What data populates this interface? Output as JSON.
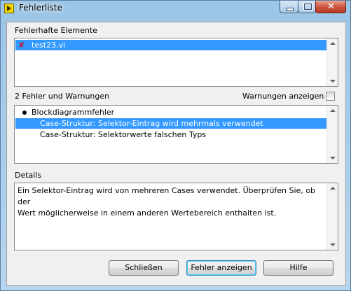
{
  "window": {
    "title": "Fehlerliste"
  },
  "errors_section": {
    "label": "Fehlerhafte Elemente",
    "items": [
      {
        "label": "test23.vi",
        "selected": true
      }
    ]
  },
  "warnings_section": {
    "label": "2 Fehler und Warnungen",
    "show_warnings_label": "Warnungen anzeigen",
    "show_warnings_checked": false,
    "group_label": "Blockdiagrammfehler",
    "items": [
      {
        "label": "Case-Struktur: Selektor-Eintrag wird mehrmals verwendet",
        "selected": true
      },
      {
        "label": "Case-Struktur: Selektorwerte falschen Typs",
        "selected": false
      }
    ]
  },
  "details": {
    "label": "Details",
    "text_line1": "Ein Selektor-Eintrag wird von mehreren Cases verwendet.  Überprüfen Sie, ob der",
    "text_line2": "Wert möglicherweise in einem anderen Wertebereich enthalten ist."
  },
  "buttons": {
    "close": "Schließen",
    "show_error": "Fehler anzeigen",
    "help": "Hilfe"
  },
  "colors": {
    "selection": "#3399ff",
    "error_icon": "#c0182d",
    "titlebar": "#a9cfec"
  },
  "icons": {
    "app": "labview-vi-icon",
    "error": "red-x-icon"
  }
}
